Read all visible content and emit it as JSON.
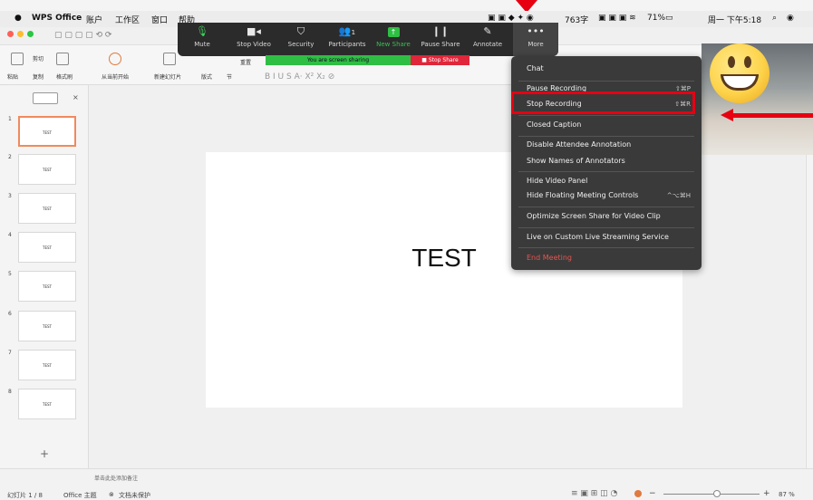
{
  "menubar": {
    "app": "WPS Office",
    "items": [
      "账户",
      "工作区",
      "窗口",
      "帮助"
    ],
    "right": {
      "chars": "763字",
      "battery": "71%",
      "datetime": "周一 下午5:18"
    }
  },
  "ribbon": {
    "paste": "粘贴",
    "cut": "剪切",
    "copy": "复制",
    "format_painter": "格式刷",
    "play_from_current": "从当前开始",
    "new_slide": "新建幻灯片",
    "layout": "版式",
    "section": "节",
    "reset": "重置"
  },
  "zoom": {
    "buttons": [
      {
        "label": "Mute",
        "icon": "mic-icon"
      },
      {
        "label": "Stop Video",
        "icon": "video-icon"
      },
      {
        "label": "Security",
        "icon": "shield-icon"
      },
      {
        "label": "Participants",
        "icon": "participants-icon"
      },
      {
        "label": "New Share",
        "icon": "share-icon"
      },
      {
        "label": "Pause Share",
        "icon": "pause-icon"
      },
      {
        "label": "Annotate",
        "icon": "pen-icon"
      },
      {
        "label": "More",
        "icon": "more-icon"
      }
    ],
    "participants_count": "1",
    "sharing_text": "You are screen sharing",
    "stop_share": "Stop Share"
  },
  "menu": {
    "items": [
      {
        "label": "Chat",
        "shortcut": ""
      },
      {
        "label": "Pause Recording",
        "shortcut": "⇧⌘P"
      },
      {
        "label": "Stop Recording",
        "shortcut": "⇧⌘R"
      },
      {
        "label": "Closed Caption",
        "shortcut": ""
      },
      {
        "label": "Disable Attendee Annotation",
        "shortcut": ""
      },
      {
        "label": "Show Names of Annotators",
        "shortcut": ""
      },
      {
        "label": "Hide Video Panel",
        "shortcut": ""
      },
      {
        "label": "Hide Floating Meeting Controls",
        "shortcut": "^⌥⌘H"
      },
      {
        "label": "Optimize Screen Share for Video Clip",
        "shortcut": ""
      },
      {
        "label": "Live on Custom Live Streaming Service",
        "shortcut": ""
      },
      {
        "label": "End Meeting",
        "shortcut": ""
      }
    ],
    "highlight_color": "#e60012"
  },
  "slides": {
    "thumb_text": "TEST",
    "numbers": [
      "1",
      "2",
      "3",
      "4",
      "5",
      "6",
      "7",
      "8"
    ],
    "selected": 1
  },
  "slide": {
    "text": "TEST"
  },
  "notes_placeholder": "单击此处添加备注",
  "status": {
    "slide_counter": "幻灯片 1 / 8",
    "theme": "Office 主题",
    "protect": "文档未保护",
    "zoom": "87 %"
  }
}
